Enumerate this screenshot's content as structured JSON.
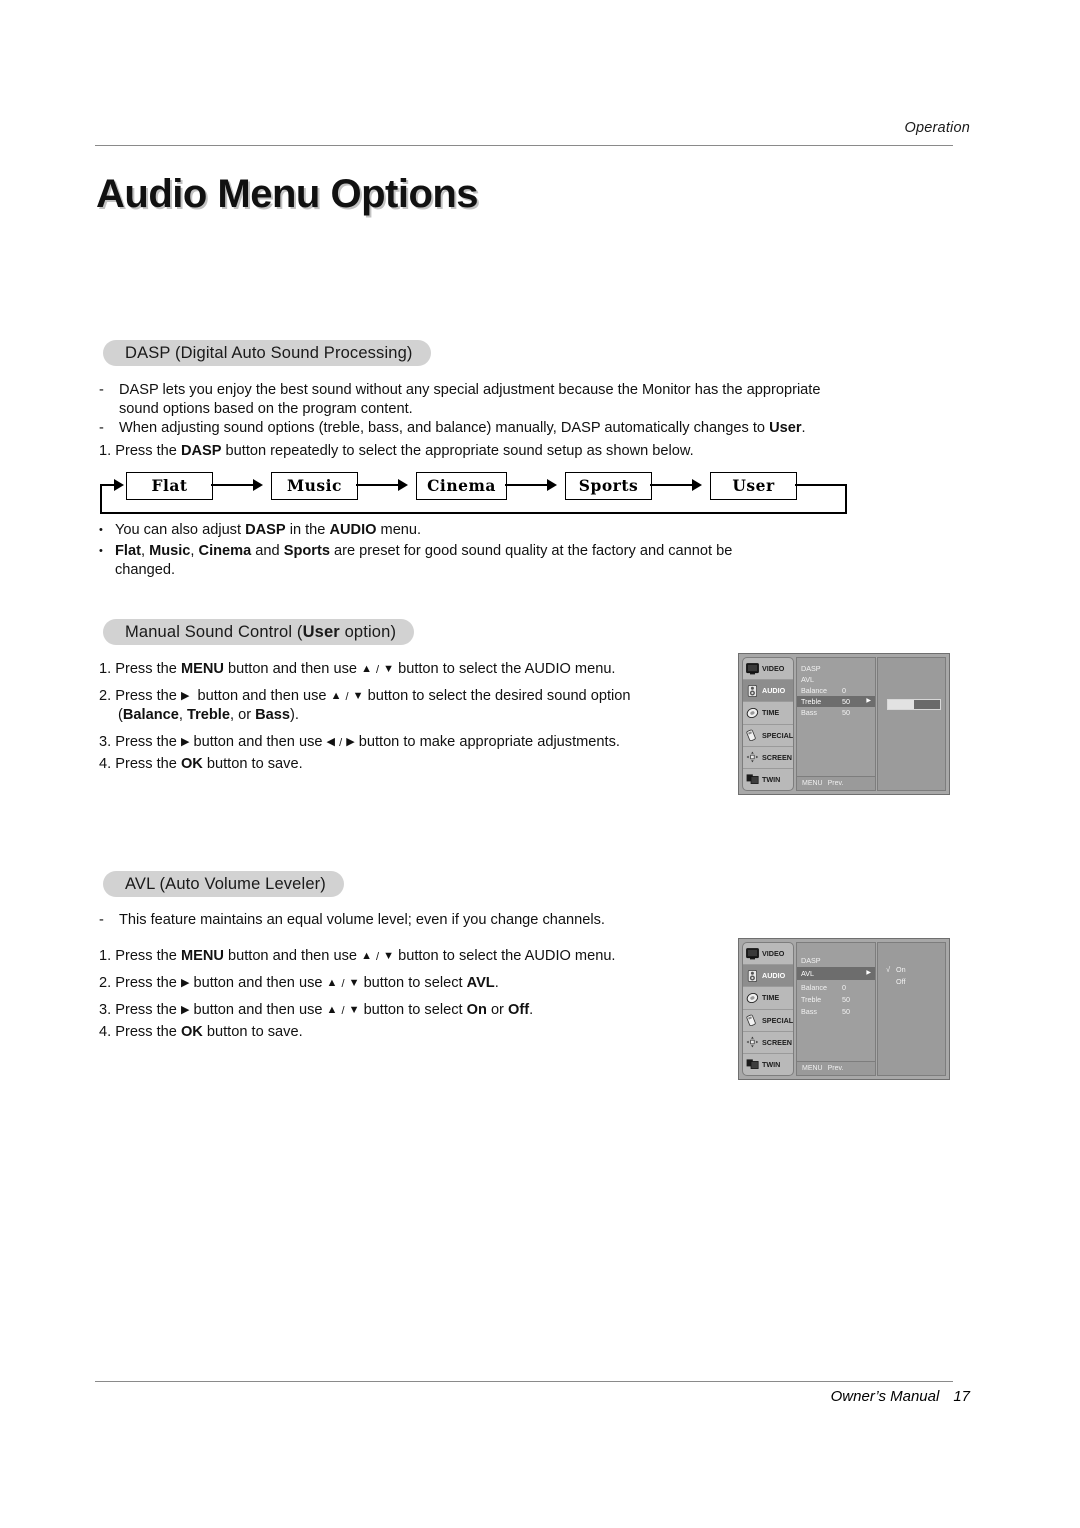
{
  "header": {
    "running_head": "Operation"
  },
  "title": "Audio Menu Options",
  "sections": {
    "dasp": {
      "heading_plain": "DASP (Digital Auto Sound Processing)",
      "bullets": [
        "DASP lets you enjoy the best sound without any special adjustment because the Monitor has the appropriate",
        "sound options based on the program content.",
        "When adjusting sound options (treble, bass, and balance) manually, DASP automatically changes to User."
      ],
      "step1": "1. Press the DASP button repeatedly to select the appropriate sound setup as shown below.",
      "flow": [
        "Flat",
        "Music",
        "Cinema",
        "Sports",
        "User"
      ],
      "notes": [
        "You can also adjust DASP in the AUDIO menu.",
        "Flat, Music, Cinema and Sports are preset for good sound quality at the factory and cannot be",
        "changed."
      ],
      "dash": "-",
      "bullet_glyph": "•"
    },
    "manual": {
      "heading_pre": "Manual Sound Control (",
      "heading_bold": "User",
      "heading_post": " option)",
      "steps": [
        "1. Press the MENU button and then use ▲ / ▼ button to select the AUDIO menu.",
        "2. Press the ▶ button and then use ▲ / ▼ button to select the desired sound option",
        "(Balance, Treble, or Bass).",
        "3. Press the ▶ button and then use ◀ / ▶ button to make appropriate adjustments.",
        "4. Press the OK button to save."
      ]
    },
    "avl": {
      "heading_plain": "AVL (Auto Volume Leveler)",
      "bullet": "This feature maintains an equal volume level; even if you change channels.",
      "dash": "-",
      "steps": [
        "1. Press the MENU button and then use ▲ / ▼ button to select the AUDIO menu.",
        "2. Press the ▶ button and then use ▲ / ▼ button to select AVL.",
        "3. Press the ▶ button and then use ▲ / ▼ button to select On or Off.",
        "4. Press the OK button to save."
      ]
    }
  },
  "osd": {
    "sidebar": [
      {
        "label": "VIDEO",
        "icon": "monitor-icon",
        "selected": false
      },
      {
        "label": "AUDIO",
        "icon": "speaker-icon",
        "selected": true
      },
      {
        "label": "TIME",
        "icon": "clock-icon",
        "selected": false
      },
      {
        "label": "SPECIAL",
        "icon": "remote-icon",
        "selected": false
      },
      {
        "label": "SCREEN",
        "icon": "screen-icon",
        "selected": false
      },
      {
        "label": "TWIN",
        "icon": "twin-icon",
        "selected": false
      }
    ],
    "footer": {
      "menu": "MENU",
      "prev": "Prev."
    },
    "treble": {
      "rows": [
        {
          "label": "DASP",
          "value": "",
          "caret": "",
          "highlight": false
        },
        {
          "label": "AVL",
          "value": "",
          "caret": "",
          "highlight": false
        },
        {
          "label": "Balance",
          "value": "0",
          "caret": "",
          "highlight": false
        },
        {
          "label": "Treble",
          "value": "50",
          "caret": "▶",
          "highlight": true
        },
        {
          "label": "Bass",
          "value": "50",
          "caret": "",
          "highlight": false
        }
      ],
      "slider_percent": 50
    },
    "avl": {
      "rows": [
        {
          "label": "DASP",
          "value": "",
          "caret": "",
          "highlight": false
        },
        {
          "label": "AVL",
          "value": "",
          "caret": "▶",
          "highlight": true
        },
        {
          "label": "Balance",
          "value": "0",
          "caret": "",
          "highlight": false
        },
        {
          "label": "Treble",
          "value": "50",
          "caret": "",
          "highlight": false
        },
        {
          "label": "Bass",
          "value": "50",
          "caret": "",
          "highlight": false
        }
      ],
      "options": [
        {
          "label": "On",
          "checked": true,
          "check_glyph": "√"
        },
        {
          "label": "Off",
          "checked": false,
          "check_glyph": ""
        }
      ]
    }
  },
  "footer": {
    "manual": "Owner’s Manual",
    "page": "17"
  },
  "colors": {
    "pill_bg": "#d2d2d2",
    "rule": "#8a8a8a",
    "osd_bg": "#a8a8a8",
    "osd_highlight": "#6d6d6d"
  }
}
